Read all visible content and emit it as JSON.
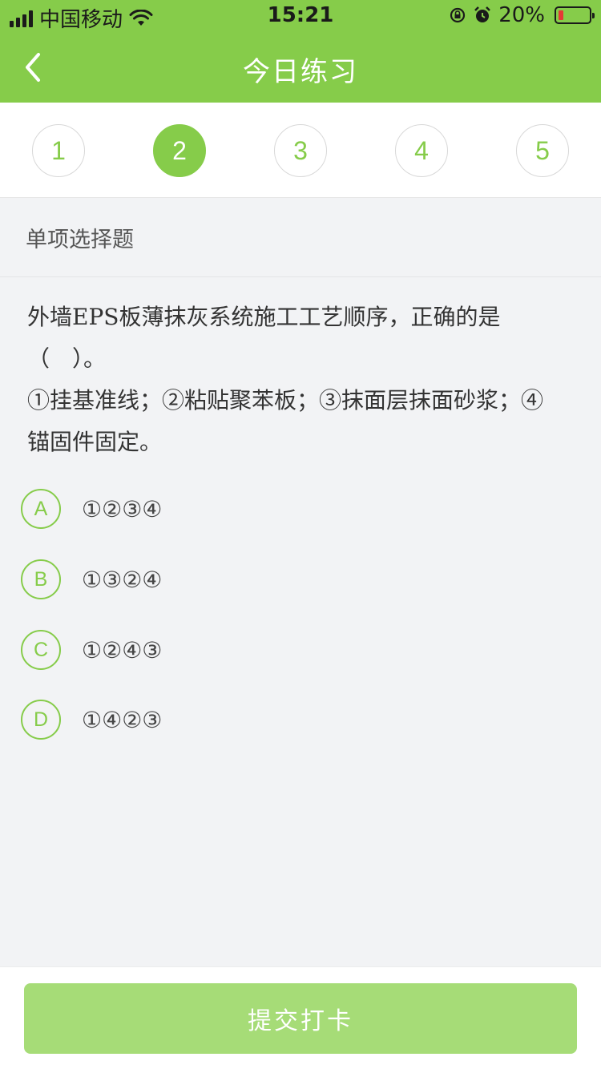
{
  "status_bar": {
    "carrier": "中国移动",
    "time": "15:21",
    "battery": "20%"
  },
  "nav": {
    "title": "今日练习"
  },
  "steps": [
    "1",
    "2",
    "3",
    "4",
    "5"
  ],
  "question_type": "单项选择题",
  "question": {
    "line1": "外墙EPS板薄抹灰系统施工工艺顺序，正确的是",
    "line2": "（　）。",
    "line3": "①挂基准线；②粘贴聚苯板；③抹面层抹面砂浆；④",
    "line4": "锚固件固定。"
  },
  "options": [
    {
      "key": "A",
      "text": "①②③④"
    },
    {
      "key": "B",
      "text": "①③②④"
    },
    {
      "key": "C",
      "text": "①②④③"
    },
    {
      "key": "D",
      "text": "①④②③"
    }
  ],
  "submit_label": "提交打卡",
  "colors": {
    "accent": "#86cc4a",
    "accent_light": "#a6dc77",
    "battery_low": "#e53935"
  }
}
